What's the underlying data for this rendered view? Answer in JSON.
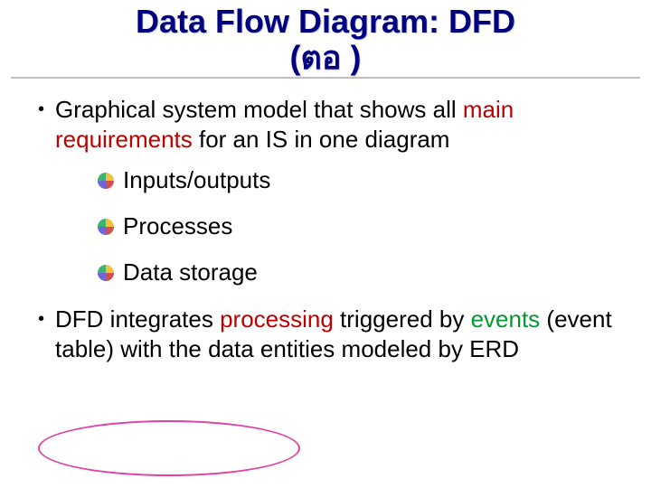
{
  "title": {
    "line1": "Data Flow Diagram: DFD",
    "line2": "(ตอ  )"
  },
  "bullet1": {
    "prefix": "Graphical system model that shows all ",
    "emph": "main requirements",
    "suffix": " for an IS in one diagram"
  },
  "sub": {
    "item1": "Inputs/outputs",
    "item2": "Processes",
    "item3": "Data storage"
  },
  "bullet2": {
    "p1": "DFD integrates ",
    "p2": "processing",
    "p3": " triggered by ",
    "p4": "events",
    "p5": " (event table) with the data entities modeled by ERD"
  }
}
